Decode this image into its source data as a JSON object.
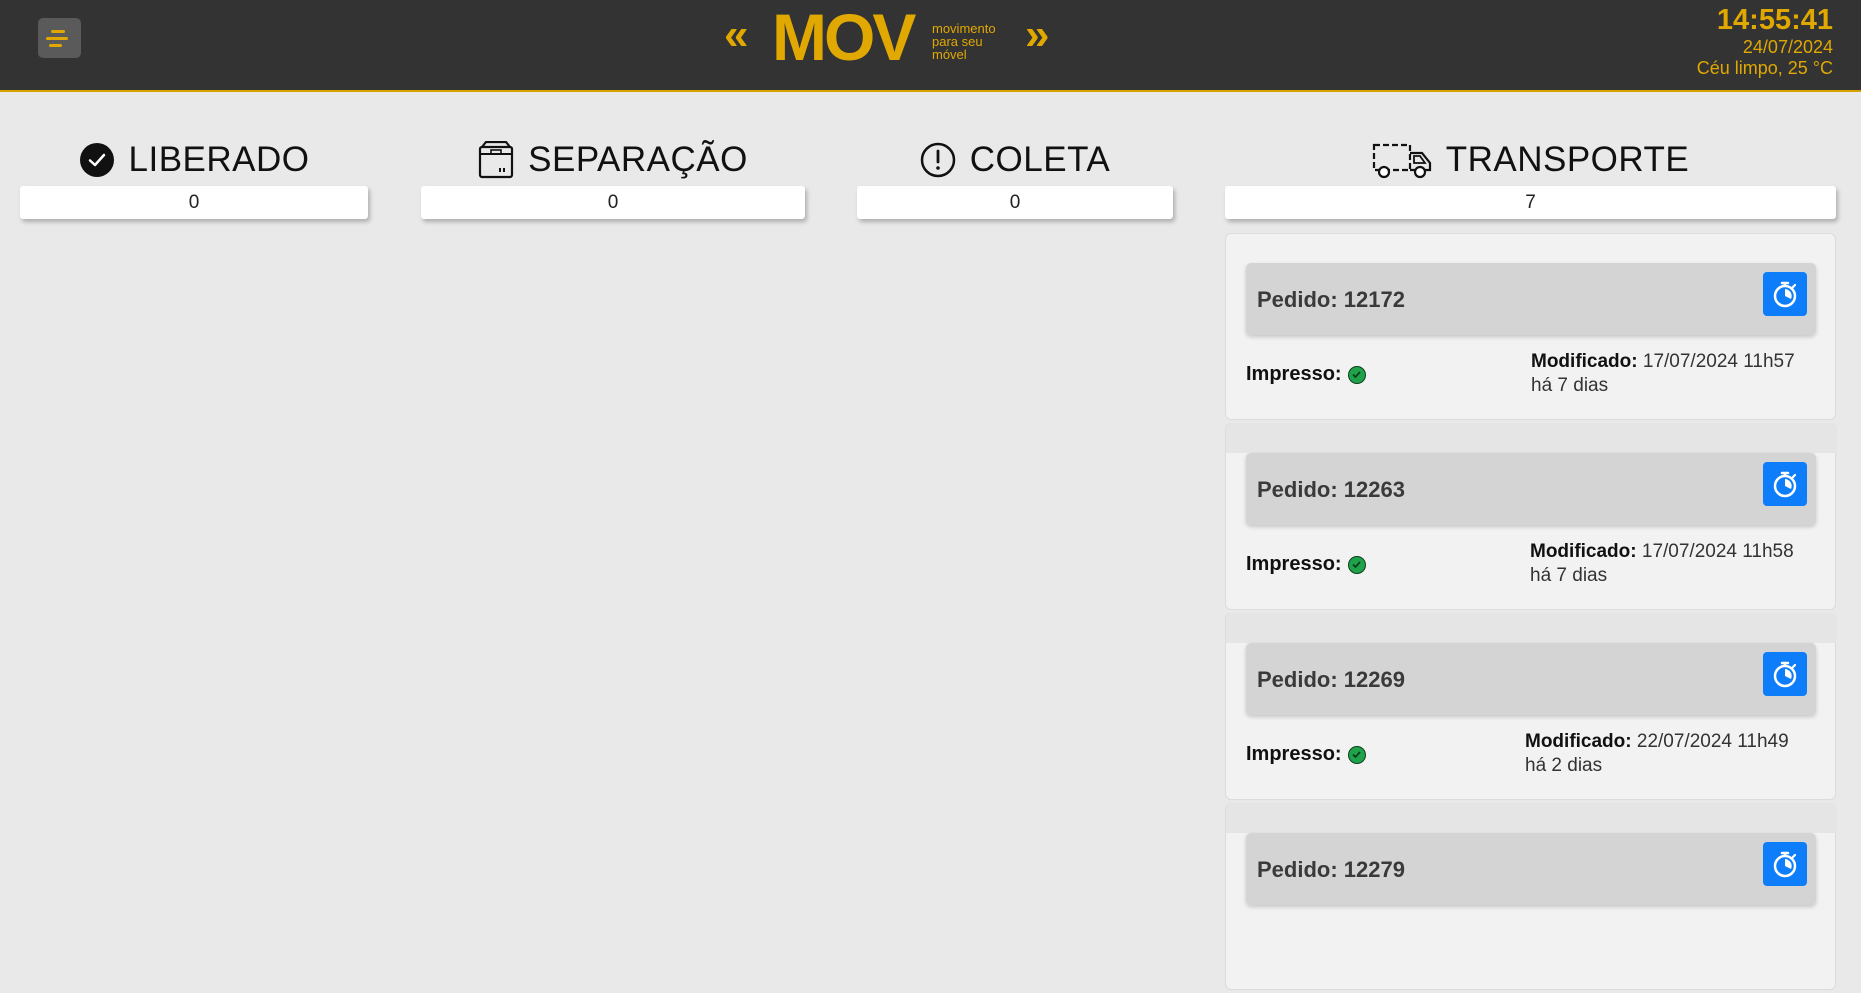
{
  "header": {
    "menu_icon": "menu-icon",
    "prev_label": "«",
    "next_label": "»",
    "logo": "MOV",
    "logo_sub": [
      "movimento",
      "para seu",
      "móvel"
    ],
    "time": "14:55:41",
    "date": "24/07/2024",
    "weather": "Céu limpo, 25 °C",
    "accent_color": "#e0a800",
    "bar_color": "#333333"
  },
  "columns": [
    {
      "title": "LIBERADO",
      "icon": "check-circle-icon",
      "count": "0"
    },
    {
      "title": "SEPARAÇÃO",
      "icon": "box-icon",
      "count": "0"
    },
    {
      "title": "COLETA",
      "icon": "exclamation-circle-icon",
      "count": "0"
    },
    {
      "title": "TRANSPORTE",
      "icon": "truck-icon",
      "count": "7"
    }
  ],
  "transport_cards": [
    {
      "title": "Pedido: 12172",
      "printed_label": "Impresso:",
      "modified_label": "Modificado:",
      "modified_value": "17/07/2024 11h57",
      "ago": "há 7 dias"
    },
    {
      "title": "Pedido: 12263",
      "printed_label": "Impresso:",
      "modified_label": "Modificado:",
      "modified_value": "17/07/2024 11h58",
      "ago": "há 7 dias"
    },
    {
      "title": "Pedido: 12269",
      "printed_label": "Impresso:",
      "modified_label": "Modificado:",
      "modified_value": "22/07/2024 11h49",
      "ago": "há 2 dias"
    },
    {
      "title": "Pedido: 12279"
    }
  ],
  "colors": {
    "timer_button": "#0d7dfa",
    "printed_check": "#1fa34a"
  }
}
